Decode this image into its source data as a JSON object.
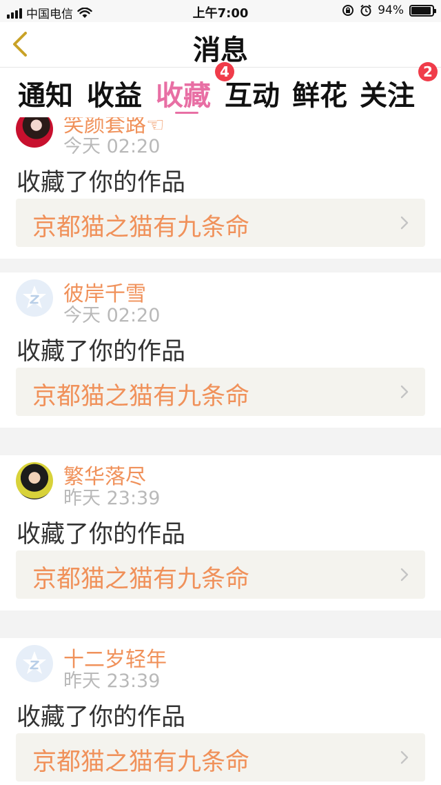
{
  "status_bar": {
    "carrier": "中国电信",
    "time": "上午7:00",
    "battery": "94%",
    "battery_level": 0.94,
    "icons": [
      "signal-icon",
      "wifi-icon",
      "orientation-lock-icon",
      "alarm-icon",
      "battery-icon"
    ]
  },
  "nav": {
    "title": "消息",
    "back_icon": "chevron-left-icon"
  },
  "tabs": [
    {
      "label": "通知"
    },
    {
      "label": "收益"
    },
    {
      "label": "收藏",
      "active": true,
      "badge": "4"
    },
    {
      "label": "互动"
    },
    {
      "label": "鲜花"
    },
    {
      "label": "关注",
      "badge": "2"
    }
  ],
  "colors": {
    "accent_pink": "#e86fa4",
    "name_orange": "#f0915a",
    "badge_red": "#f03c4a",
    "work_bg": "#f4f3ee"
  },
  "items": [
    {
      "username": "笑颜套路☜",
      "time": "今天 02:20",
      "action": "收藏了你的作品",
      "work_title": "京都猫之猫有九条命",
      "avatar": "photo-avatar"
    },
    {
      "username": "彼岸千雪",
      "time": "今天 02:20",
      "action": "收藏了你的作品",
      "work_title": "京都猫之猫有九条命",
      "avatar": "default-avatar"
    },
    {
      "username": "繁华落尽",
      "time": "昨天 23:39",
      "action": "收藏了你的作品",
      "work_title": "京都猫之猫有九条命",
      "avatar": "photo-avatar"
    },
    {
      "username": "十二岁轻年",
      "time": "昨天 23:39",
      "action": "收藏了你的作品",
      "work_title": "京都猫之猫有九条命",
      "avatar": "default-avatar"
    }
  ]
}
